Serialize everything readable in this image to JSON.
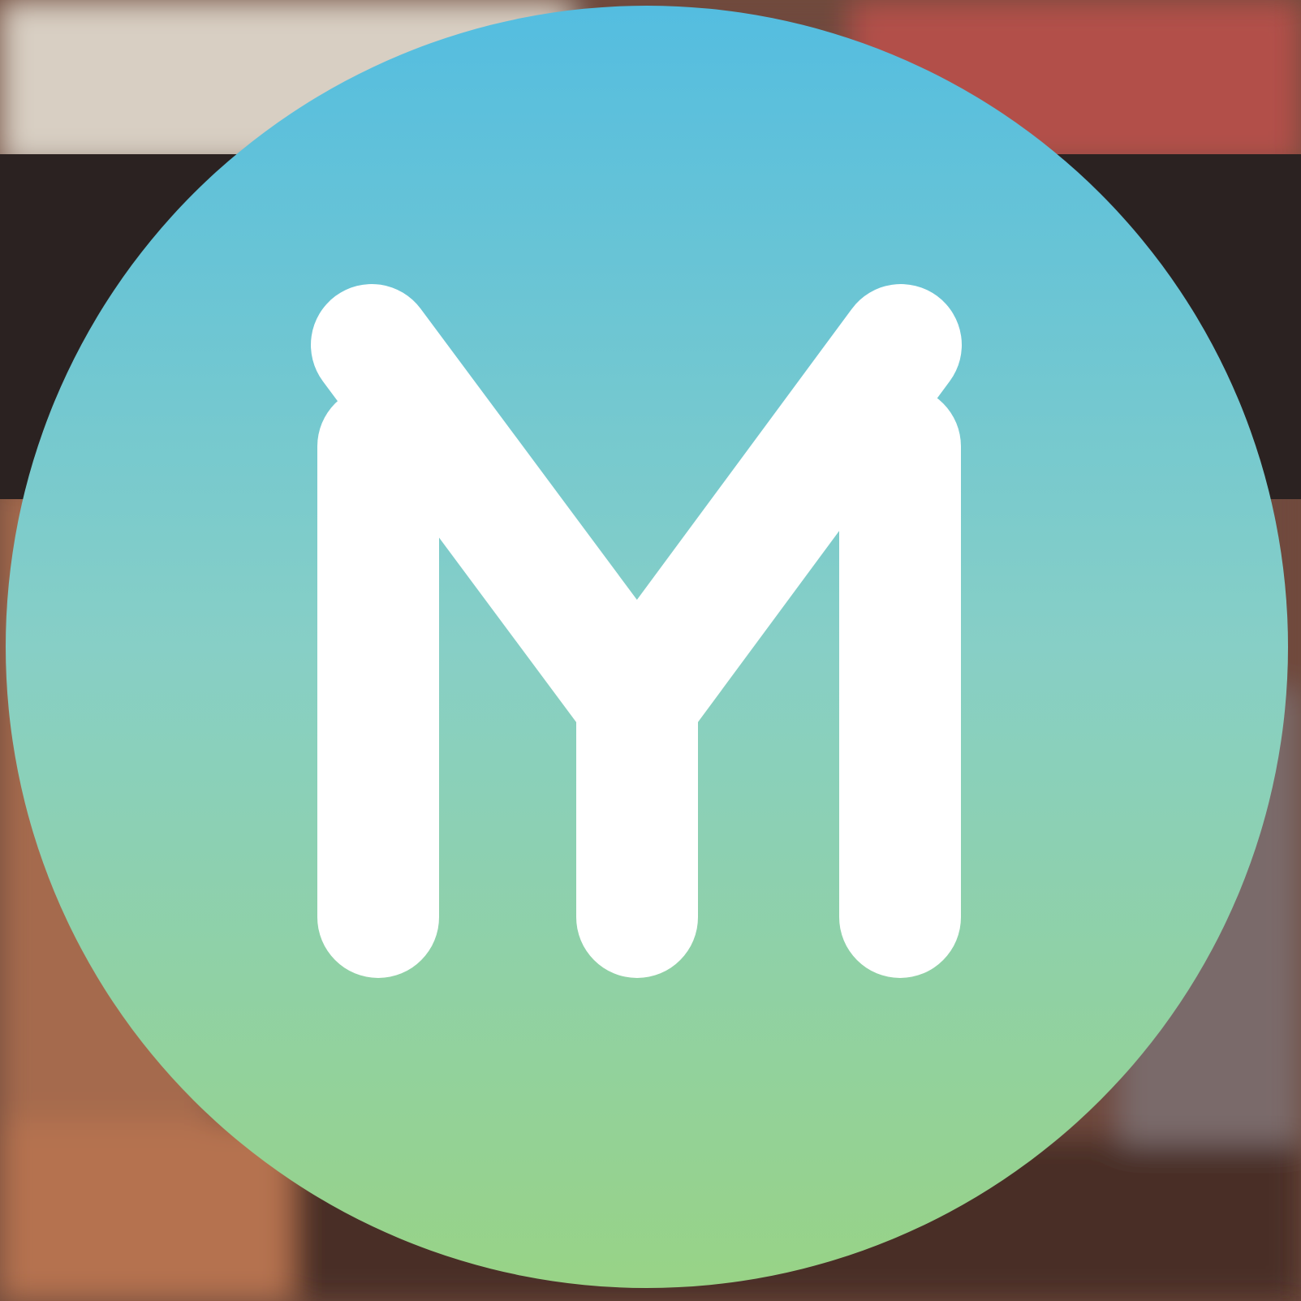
{
  "colors": {
    "badge_gradient_top": "#54bde0",
    "badge_gradient_mid": "#87cfc6",
    "badge_gradient_bottom": "#98d386",
    "glyph": "#ffffff",
    "dark_band": "#2b2221",
    "photo_warm": "#b24f49",
    "photo_skin": "#a56a4e",
    "photo_dark": "#4a2e27",
    "photo_light": "#d8cfc3",
    "photo_grey": "#7a6a6a"
  },
  "icons": {
    "logo": "m-monogram-badge-icon"
  }
}
